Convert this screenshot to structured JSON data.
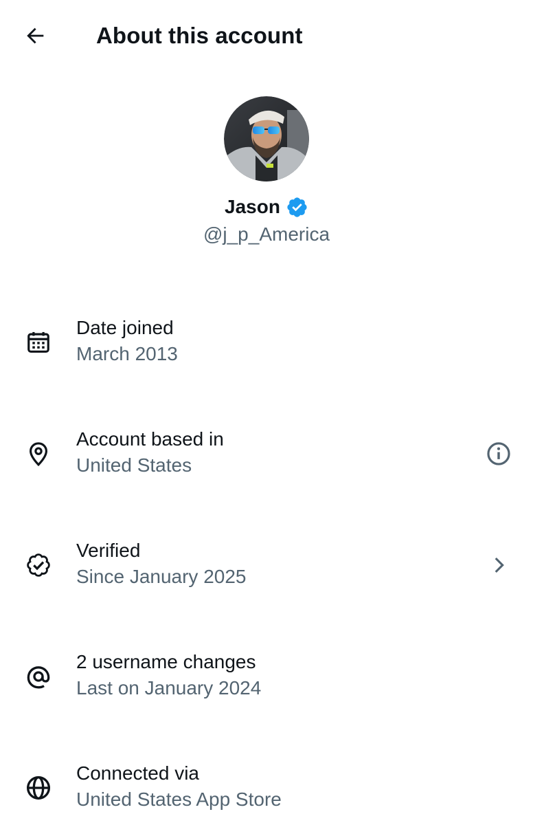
{
  "header": {
    "title": "About this account",
    "back_icon": "arrow-left-icon"
  },
  "profile": {
    "display_name": "Jason",
    "handle": "@j_p_America",
    "verified": true,
    "badge_color": "#1d9bf0"
  },
  "rows": [
    {
      "icon": "calendar-icon",
      "title": "Date joined",
      "subtitle": "March 2013",
      "action": null
    },
    {
      "icon": "location-pin-icon",
      "title": "Account based in",
      "subtitle": "United States",
      "action": "info-icon"
    },
    {
      "icon": "verified-badge-icon",
      "title": "Verified",
      "subtitle": "Since January 2025",
      "action": "chevron-right-icon"
    },
    {
      "icon": "at-sign-icon",
      "title": "2 username changes",
      "subtitle": "Last on January 2024",
      "action": null
    },
    {
      "icon": "globe-icon",
      "title": "Connected via",
      "subtitle": "United States App Store",
      "action": null
    }
  ],
  "colors": {
    "text_primary": "#0f1419",
    "text_secondary": "#536471",
    "accent": "#1d9bf0",
    "background": "#ffffff"
  }
}
